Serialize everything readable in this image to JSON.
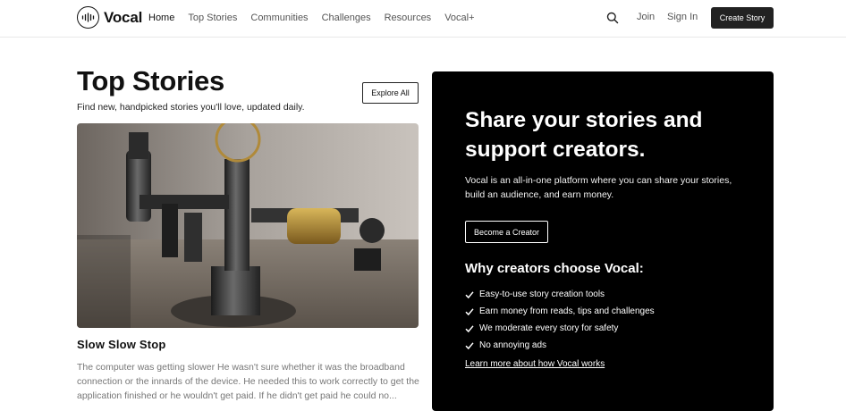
{
  "header": {
    "logo_text": "Vocal",
    "nav": [
      {
        "label": "Home",
        "active": true
      },
      {
        "label": "Top Stories",
        "active": false
      },
      {
        "label": "Communities",
        "active": false
      },
      {
        "label": "Challenges",
        "active": false
      },
      {
        "label": "Resources",
        "active": false
      },
      {
        "label": "Vocal+",
        "active": false
      }
    ],
    "search_icon": "search-icon",
    "join_label": "Join",
    "signin_label": "Sign In",
    "create_label": "Create Story"
  },
  "top_stories": {
    "title": "Top Stories",
    "subtitle": "Find new, handpicked stories you'll love, updated daily.",
    "explore_label": "Explore All",
    "featured": {
      "title": "Slow Slow Stop",
      "excerpt": "The computer was getting slower He wasn't sure whether it was the broadband connection or the innards of the device. He needed this to work correctly to get the application finished or he wouldn't get paid. If he didn't get paid he could no..."
    }
  },
  "promo": {
    "heading": "Share your stories and support creators.",
    "body": "Vocal is an all-in-one platform where you can share your stories, build an audience, and earn money.",
    "cta_label": "Become a Creator",
    "why_heading": "Why creators choose Vocal:",
    "benefits": [
      "Easy-to-use story creation tools",
      "Earn money from reads, tips and challenges",
      "We moderate every story for safety",
      "No annoying ads"
    ],
    "learn_more": "Learn more about how Vocal works"
  },
  "colors": {
    "text": "#111111",
    "muted": "#777777",
    "nav_text": "#555555",
    "promo_bg": "#000000",
    "button_dark": "#222222",
    "border": "#e8e8e8"
  }
}
